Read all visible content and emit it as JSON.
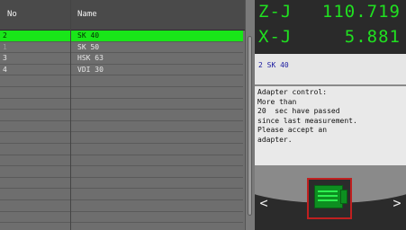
{
  "table": {
    "headers": {
      "no": "No",
      "name": "Name"
    },
    "rows": [
      {
        "no": "2",
        "name": "SK 40",
        "selected": true
      },
      {
        "no": "1",
        "name": "SK 50",
        "selected": false
      },
      {
        "no": "3",
        "name": "HSK 63",
        "selected": false
      },
      {
        "no": "4",
        "name": "VDI 30",
        "selected": false
      },
      {
        "no": "",
        "name": "",
        "selected": false
      },
      {
        "no": "",
        "name": "",
        "selected": false
      },
      {
        "no": "",
        "name": "",
        "selected": false
      },
      {
        "no": "",
        "name": "",
        "selected": false
      },
      {
        "no": "",
        "name": "",
        "selected": false
      },
      {
        "no": "",
        "name": "",
        "selected": false
      },
      {
        "no": "",
        "name": "",
        "selected": false
      },
      {
        "no": "",
        "name": "",
        "selected": false
      },
      {
        "no": "",
        "name": "",
        "selected": false
      },
      {
        "no": "",
        "name": "",
        "selected": false
      },
      {
        "no": "",
        "name": "",
        "selected": false
      },
      {
        "no": "",
        "name": "",
        "selected": false
      },
      {
        "no": "",
        "name": "",
        "selected": false
      }
    ]
  },
  "coords": {
    "z": {
      "axis": "Z-J",
      "value": "110.719"
    },
    "x": {
      "axis": "X-J",
      "value": "5.881"
    }
  },
  "tool_line": "2 SK 40",
  "message": "Adapter control:\nMore than\n20  sec have passed\nsince last measurement.\nPlease accept an\nadapter.",
  "nav": {
    "left_arrow": "<",
    "right_arrow": ">"
  },
  "colors": {
    "selected_row": "#19e619",
    "coord_text": "#20e020",
    "adapter_frame": "#c02020"
  }
}
